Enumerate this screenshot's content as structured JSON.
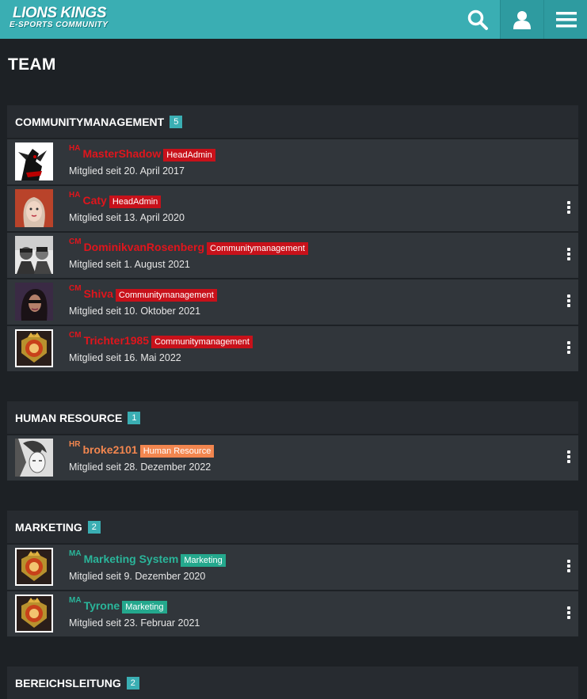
{
  "header": {
    "logo_line1": "LIONS KINGS",
    "logo_line2": "E-SPORTS COMMUNITY",
    "search_icon": "search-icon",
    "user_icon": "user-icon",
    "menu_icon": "hamburger-menu-icon",
    "bg_color": "#3aaeb3"
  },
  "page": {
    "title": "TEAM"
  },
  "sections": [
    {
      "title": "COMMUNITYMANAGEMENT",
      "count": "5",
      "members": [
        {
          "abbr": "HA",
          "name": "MasterShadow",
          "badge": "HeadAdmin",
          "since": "Mitglied seit 20. April 2017",
          "menu": false
        },
        {
          "abbr": "HA",
          "name": "Caty",
          "badge": "HeadAdmin",
          "since": "Mitglied seit 13. April 2020",
          "menu": true
        },
        {
          "abbr": "CM",
          "name": "DominikvanRosenberg",
          "badge": "Communitymanagement",
          "since": "Mitglied seit 1. August 2021",
          "menu": true
        },
        {
          "abbr": "CM",
          "name": "Shiva",
          "badge": "Communitymanagement",
          "since": "Mitglied seit 10. Oktober 2021",
          "menu": true
        },
        {
          "abbr": "CM",
          "name": "Trichter1985",
          "badge": "Communitymanagement",
          "since": "Mitglied seit 16. Mai 2022",
          "menu": true
        }
      ]
    },
    {
      "title": "HUMAN RESOURCE",
      "count": "1",
      "members": [
        {
          "abbr": "HR",
          "name": "broke2101",
          "badge": "Human Resource",
          "since": "Mitglied seit 28. Dezember 2022",
          "menu": true
        }
      ]
    },
    {
      "title": "MARKETING",
      "count": "2",
      "members": [
        {
          "abbr": "MA",
          "name": "Marketing System",
          "badge": "Marketing",
          "since": "Mitglied seit 9. Dezember 2020",
          "menu": true
        },
        {
          "abbr": "MA",
          "name": "Tyrone",
          "badge": "Marketing",
          "since": "Mitglied seit 23. Februar 2021",
          "menu": true
        }
      ]
    },
    {
      "title": "BEREICHSLEITUNG",
      "count": "2",
      "members": []
    }
  ],
  "colors": {
    "headadmin": "#c8111a",
    "communitymanagement": "#c8111a",
    "human_resource": "#f2864f",
    "marketing": "#24a88d",
    "count_badge": "#3aaeb3"
  }
}
